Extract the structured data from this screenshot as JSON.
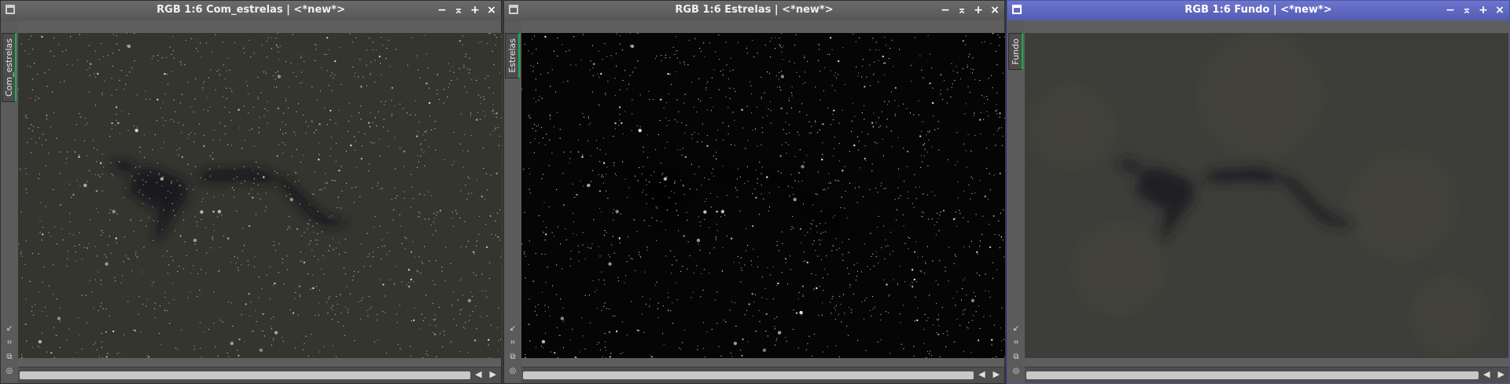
{
  "windows": [
    {
      "id": "w1",
      "title": "RGB 1:6 Com_estrelas | <*new*>",
      "view_tab": "Com_estrelas",
      "active": false,
      "image": "stars_with_nebula"
    },
    {
      "id": "w2",
      "title": "RGB 1:6 Estrelas | <*new*>",
      "view_tab": "Estrelas",
      "active": false,
      "image": "stars_only"
    },
    {
      "id": "w3",
      "title": "RGB 1:6 Fundo | <*new*>",
      "view_tab": "Fundo",
      "active": true,
      "image": "starless_background"
    }
  ],
  "controls": {
    "minimize": "−",
    "shade": "⌅",
    "maximize": "+",
    "close": "×"
  },
  "side_tools": [
    "↙",
    "⌗",
    "⧉",
    "◎"
  ],
  "scroll_arrows": {
    "left": "◀",
    "right": "▶"
  },
  "colors": {
    "active_title": "#5a62bd",
    "inactive_title": "#616161",
    "view_tab_accent": "#18b04a"
  }
}
